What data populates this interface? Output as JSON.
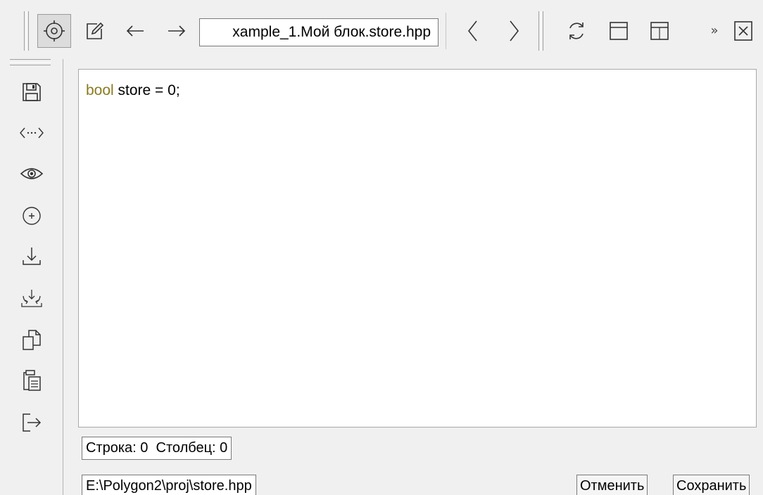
{
  "toolbar": {
    "address_text": "xample_1.Мой блок.store.hpp",
    "overflow_glyph": "»",
    "icons": [
      "locate-icon",
      "edit-icon",
      "back-arrow-icon",
      "forward-arrow-icon",
      "prev-chevron-icon",
      "next-chevron-icon",
      "refresh-icon",
      "layout-horizontal-icon",
      "layout-vertical-icon",
      "close-icon"
    ]
  },
  "sidebar": {
    "icons": [
      "save-icon",
      "code-icon",
      "eye-icon",
      "add-circle-icon",
      "download-icon",
      "merge-icon",
      "copy-icon",
      "paste-icon",
      "exit-icon"
    ]
  },
  "editor": {
    "keyword": "bool",
    "code_rest": " store = 0;",
    "keyword_color": "#8b7a1e"
  },
  "status": {
    "position_text": "Строка: 0  Столбец: 0",
    "file_path": "E:\\Polygon2\\proj\\store.hpp"
  },
  "buttons": {
    "cancel": "Отменить",
    "save": "Сохранить"
  }
}
